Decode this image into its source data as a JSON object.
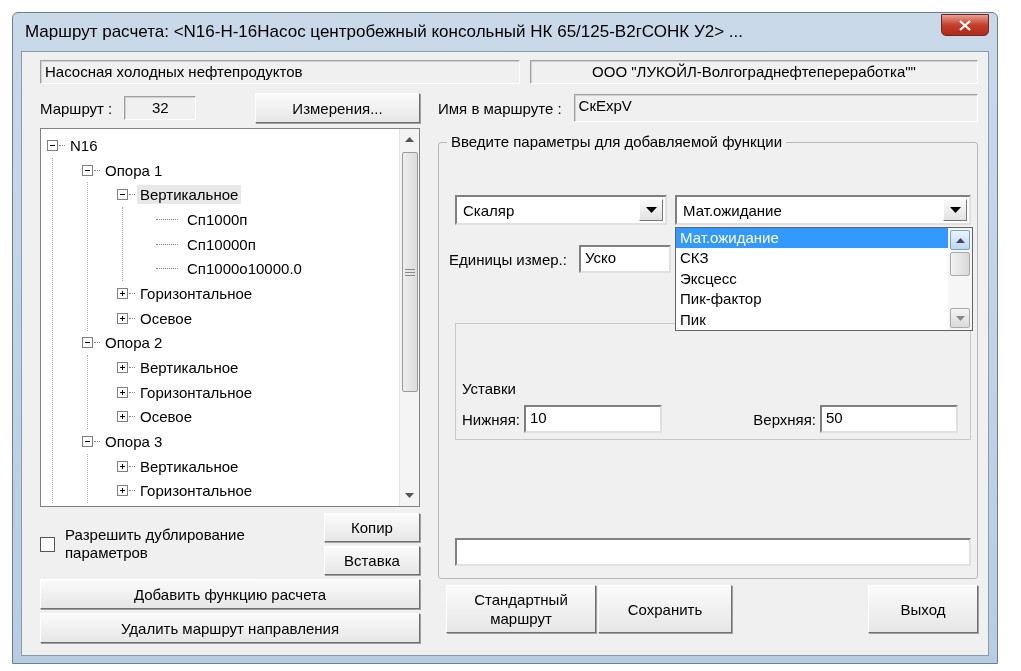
{
  "window": {
    "title": "Маршрут расчета: <N16-Н-16Насос центробежный консольный НК 65/125-В2гСОНК У2> ..."
  },
  "header": {
    "location": "Насосная холодных нефтепродуктов",
    "company": "ООО \"ЛУКОЙЛ-Волгограднефтепереработка\"\""
  },
  "route": {
    "label": "Маршрут :",
    "number": "32"
  },
  "measurements_button": "Измерения...",
  "tree": [
    {
      "label": "N16",
      "kind": "branch",
      "expanded": true,
      "selected": false,
      "children": [
        {
          "label": "Опора 1",
          "kind": "branch",
          "expanded": true,
          "selected": false,
          "children": [
            {
              "label": "Вертикальное",
              "kind": "branch",
              "expanded": true,
              "selected": true,
              "children": [
                {
                  "label": "Сп1000п",
                  "kind": "leaf",
                  "selected": false
                },
                {
                  "label": "Сп10000п",
                  "kind": "leaf",
                  "selected": false
                },
                {
                  "label": "Сп1000о10000.0",
                  "kind": "leaf",
                  "selected": false
                }
              ]
            },
            {
              "label": "Горизонтальное",
              "kind": "branch",
              "expanded": false,
              "selected": false
            },
            {
              "label": "Осевое",
              "kind": "branch",
              "expanded": false,
              "selected": false
            }
          ]
        },
        {
          "label": "Опора 2",
          "kind": "branch",
          "expanded": true,
          "selected": false,
          "children": [
            {
              "label": "Вертикальное",
              "kind": "branch",
              "expanded": false,
              "selected": false
            },
            {
              "label": "Горизонтальное",
              "kind": "branch",
              "expanded": false,
              "selected": false
            },
            {
              "label": "Осевое",
              "kind": "branch",
              "expanded": false,
              "selected": false
            }
          ]
        },
        {
          "label": "Опора 3",
          "kind": "branch",
          "expanded": true,
          "selected": false,
          "children": [
            {
              "label": "Вертикальное",
              "kind": "branch",
              "expanded": false,
              "selected": false
            },
            {
              "label": "Горизонтальное",
              "kind": "branch",
              "expanded": false,
              "selected": false
            }
          ]
        }
      ]
    }
  ],
  "duplicate_checkbox": {
    "label": "Разрешить дублирование параметров",
    "checked": false
  },
  "copy_button": "Копир",
  "paste_button": "Вставка",
  "add_function_button": "Добавить функцию расчета",
  "delete_route_button": "Удалить маршрут направления",
  "route_name": {
    "label": "Имя в маршруте :",
    "value": "СкExpV"
  },
  "params_group": {
    "title": "Введите параметры для добавляемой функции",
    "type_combo": "Скаляр",
    "function_combo": "Мат.ожидание",
    "function_options": [
      {
        "label": "Мат.ожидание",
        "selected": true
      },
      {
        "label": "СКЗ",
        "selected": false
      },
      {
        "label": "Эксцесс",
        "selected": false
      },
      {
        "label": "Пик-фактор",
        "selected": false
      },
      {
        "label": "Пик",
        "selected": false
      }
    ],
    "units_label": "Единицы измер.:",
    "units_value": "Уско",
    "setpoints_label": "Уставки",
    "lower_label": "Нижняя:",
    "lower_value": "10",
    "upper_label": "Верхняя:",
    "upper_value": "50"
  },
  "buttons": [
    {
      "label": "Стандартный маршрут"
    },
    {
      "label": "Сохранить"
    },
    {
      "label": "Выход"
    }
  ]
}
